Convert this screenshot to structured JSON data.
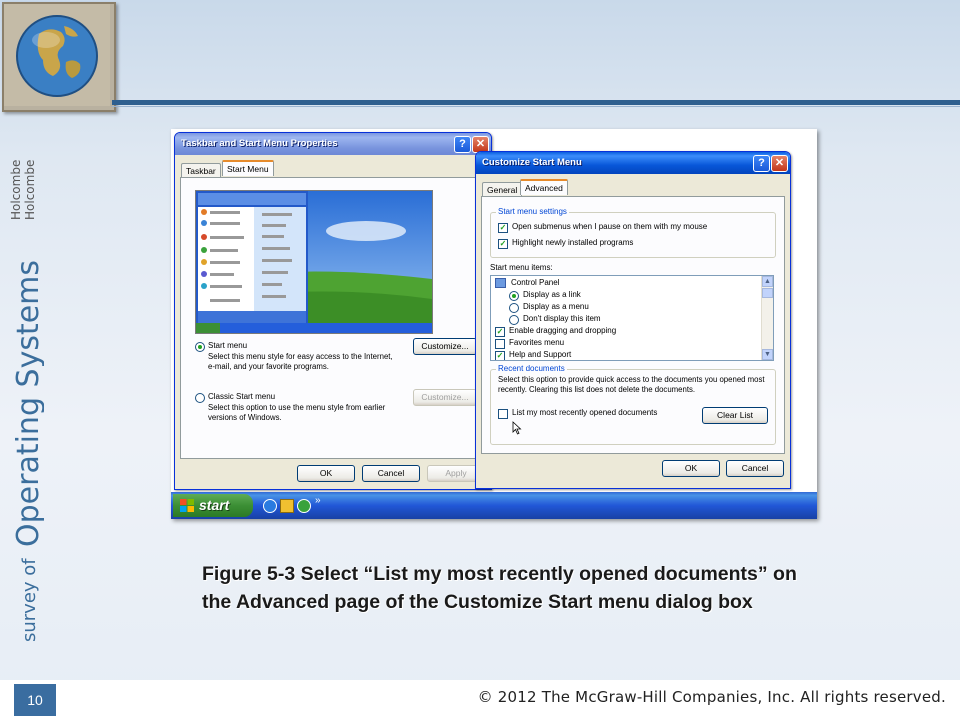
{
  "slide": {
    "side_title": {
      "prefix": "survey of",
      "main": "Operating Systems",
      "author1": "Holcombe",
      "author2": "Holcombe"
    },
    "caption": "Figure 5-3   Select “List my most recently opened documents” on the Advanced page of the Customize Start menu dialog box",
    "page_number": "10",
    "copyright": "© 2012 The McGraw-Hill Companies, Inc. All rights reserved."
  },
  "taskbar_dialog": {
    "title": "Taskbar and Start Menu Properties",
    "help_glyph": "?",
    "close_glyph": "✕",
    "tabs": [
      "Taskbar",
      "Start Menu"
    ],
    "start_menu_option": {
      "label": "Start menu",
      "desc": "Select this menu style for easy access to the Internet, e-mail, and your favorite programs.",
      "selected": true
    },
    "classic_option": {
      "label": "Classic Start menu",
      "desc": "Select this option to use the menu style from earlier versions of Windows.",
      "selected": false
    },
    "customize_label": "Customize...",
    "customize_disabled_label": "Customize...",
    "ok_label": "OK",
    "cancel_label": "Cancel",
    "apply_label": "Apply"
  },
  "customize_dialog": {
    "title": "Customize Start Menu",
    "help_glyph": "?",
    "close_glyph": "✕",
    "tabs": [
      "General",
      "Advanced"
    ],
    "settings_group": "Start menu settings",
    "setting1": "Open submenus when I pause on them with my mouse",
    "setting2": "Highlight newly installed programs",
    "items_label": "Start menu items:",
    "items": [
      {
        "label": "Control Panel",
        "kind": "header"
      },
      {
        "label": "Display as a link",
        "kind": "radio",
        "checked": true
      },
      {
        "label": "Display as a menu",
        "kind": "radio",
        "checked": false
      },
      {
        "label": "Don't display this item",
        "kind": "radio",
        "checked": false
      },
      {
        "label": "Enable dragging and dropping",
        "kind": "check",
        "checked": true
      },
      {
        "label": "Favorites menu",
        "kind": "check",
        "checked": false
      },
      {
        "label": "Help and Support",
        "kind": "check",
        "checked": true
      }
    ],
    "recent_group": "Recent documents",
    "recent_desc": "Select this option to provide quick access to the documents you opened most recently.  Clearing this list does not delete the documents.",
    "recent_check": "List my most recently opened documents",
    "clear_list_label": "Clear List",
    "ok_label": "OK",
    "cancel_label": "Cancel"
  },
  "xp_taskbar": {
    "start_label": "start",
    "chevron": "»"
  },
  "colors": {
    "accent": "#2f5f8f",
    "xp_blue": "#0857d9",
    "start_green": "#3c8f35",
    "badge": "#3a6da0"
  }
}
